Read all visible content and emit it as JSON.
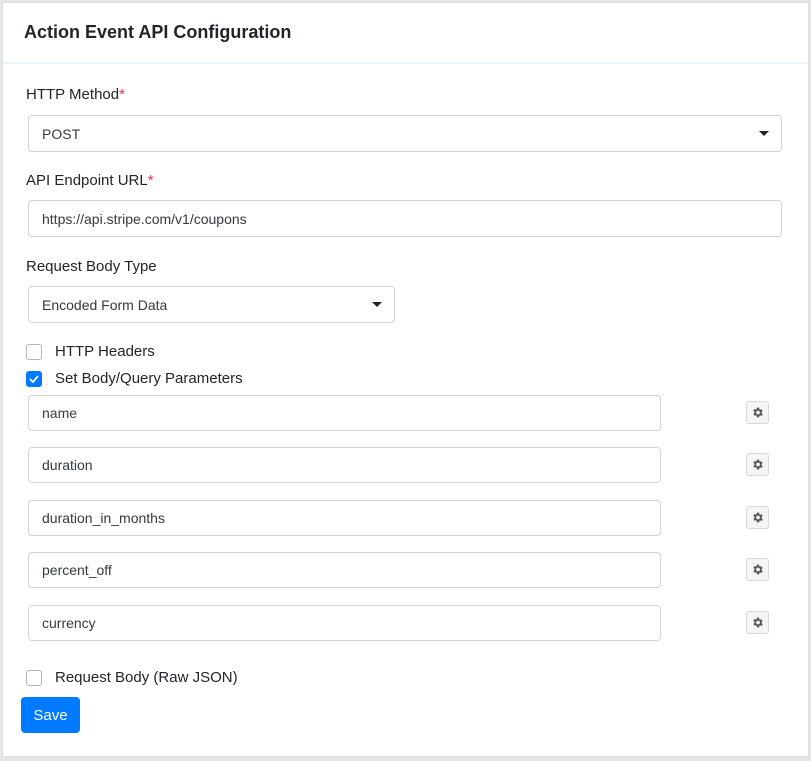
{
  "header": {
    "title": "Action Event API Configuration"
  },
  "http_method": {
    "label": "HTTP Method",
    "required_mark": "*",
    "value": "POST"
  },
  "endpoint": {
    "label": "API Endpoint URL",
    "required_mark": "*",
    "value": "https://api.stripe.com/v1/coupons"
  },
  "body_type": {
    "label": "Request Body Type",
    "value": "Encoded Form Data"
  },
  "options": {
    "http_headers": {
      "label": "HTTP Headers",
      "checked": false
    },
    "set_body_params": {
      "label": "Set Body/Query Parameters",
      "checked": true
    },
    "raw_json": {
      "label": "Request Body (Raw JSON)",
      "checked": false
    }
  },
  "params": [
    {
      "value": "name"
    },
    {
      "value": "duration"
    },
    {
      "value": "duration_in_months"
    },
    {
      "value": "percent_off"
    },
    {
      "value": "currency"
    }
  ],
  "actions": {
    "save_label": "Save"
  },
  "colors": {
    "accent": "#007bff",
    "required": "#dc3545"
  }
}
